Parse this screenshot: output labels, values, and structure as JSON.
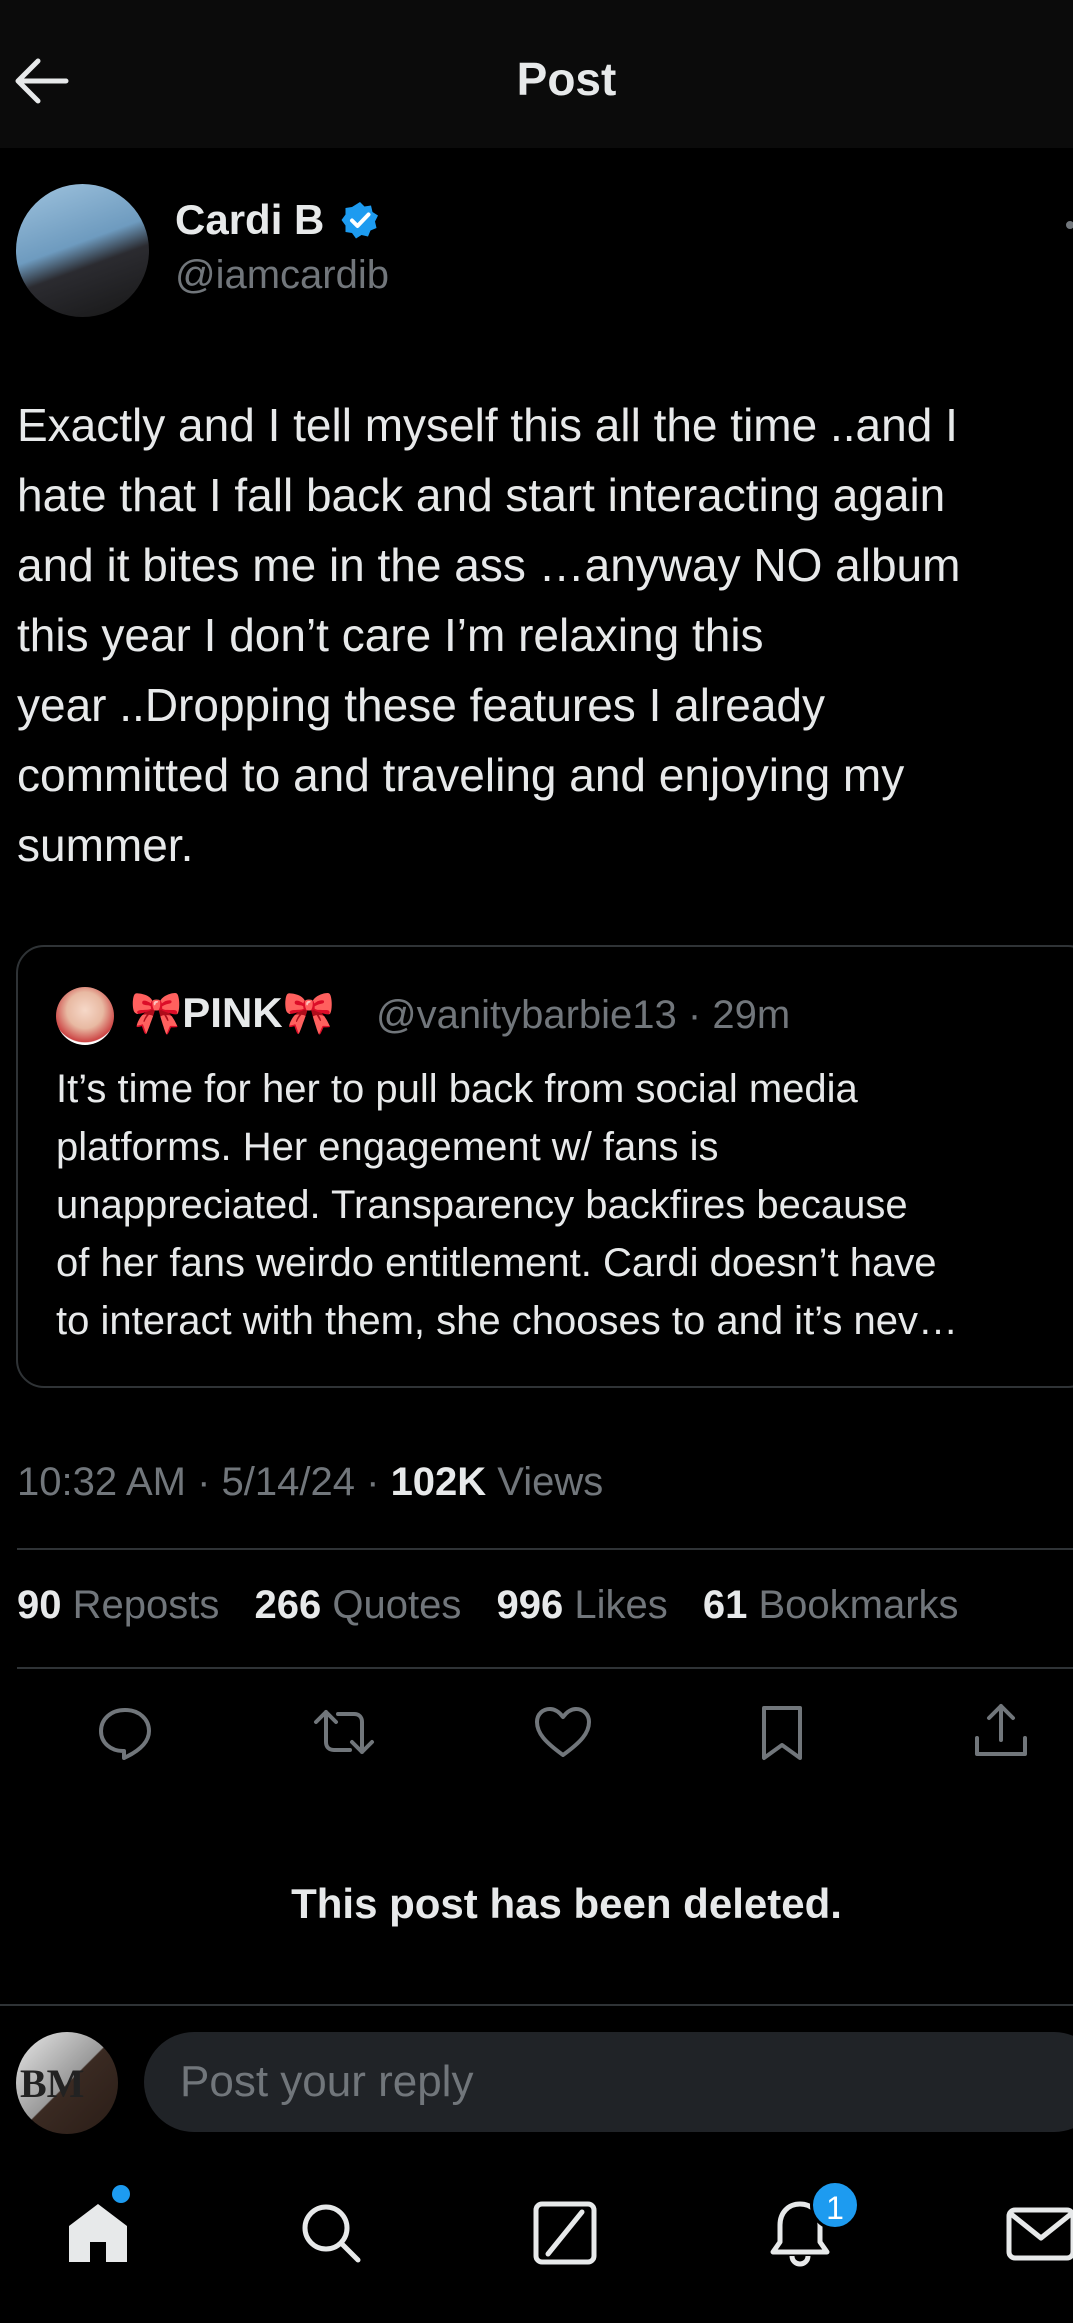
{
  "header": {
    "title": "Post"
  },
  "author": {
    "name": "Cardi B",
    "handle": "@iamcardib",
    "verified": true
  },
  "post": {
    "text": "Exactly and I tell myself this all the time ..and I\nhate that I fall back and start interacting again\nand it bites me in the ass …anyway NO album\nthis year I don’t care I’m relaxing this\nyear ..Dropping these features I already\ncommitted to and traveling and enjoying my\nsummer."
  },
  "quote": {
    "name_prefix": "🎀",
    "name": "PINK",
    "name_suffix": "🎀",
    "handle_time": "@vanitybarbie13 · 29m",
    "text": "It’s time for her to pull back from social media\nplatforms. Her engagement w/ fans is\nunappreciated. Transparency backfires because\nof her fans weirdo entitlement. Cardi doesn’t have\nto interact with them, she chooses to and it’s nev…"
  },
  "meta": {
    "datetime": "10:32 AM · 5/14/24 · ",
    "views_count": "102K",
    "views_label": " Views"
  },
  "stats": {
    "reposts_count": "90",
    "reposts_label": "Reposts",
    "quotes_count": "266",
    "quotes_label": "Quotes",
    "likes_count": "996",
    "likes_label": "Likes",
    "bookmarks_count": "61",
    "bookmarks_label": "Bookmarks"
  },
  "actions": [
    "reply-icon",
    "repost-icon",
    "like-icon",
    "bookmark-icon",
    "share-icon"
  ],
  "deleted_notice": "This post has been deleted.",
  "reply": {
    "placeholder": "Post your reply",
    "avatar_initials": "BM"
  },
  "nav": {
    "items": [
      "home-icon",
      "search-icon",
      "grok-icon",
      "notifications-icon",
      "messages-icon"
    ],
    "notification_count": "1"
  },
  "colors": {
    "accent": "#1d9bf0",
    "background": "#000000",
    "muted": "#71767b",
    "text": "#e7e9ea"
  }
}
